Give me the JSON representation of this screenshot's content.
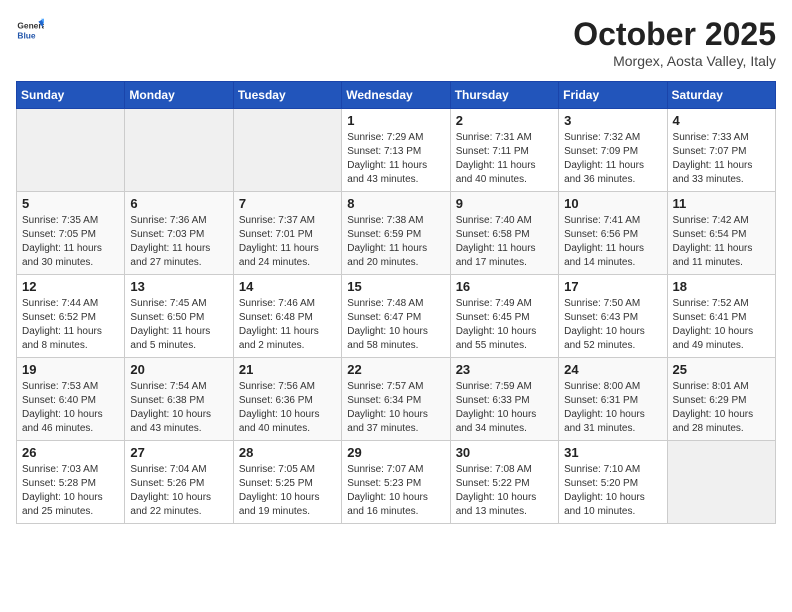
{
  "header": {
    "logo_general": "General",
    "logo_blue": "Blue",
    "month_title": "October 2025",
    "location": "Morgex, Aosta Valley, Italy"
  },
  "weekdays": [
    "Sunday",
    "Monday",
    "Tuesday",
    "Wednesday",
    "Thursday",
    "Friday",
    "Saturday"
  ],
  "weeks": [
    [
      {
        "day": "",
        "sunrise": "",
        "sunset": "",
        "daylight": ""
      },
      {
        "day": "",
        "sunrise": "",
        "sunset": "",
        "daylight": ""
      },
      {
        "day": "",
        "sunrise": "",
        "sunset": "",
        "daylight": ""
      },
      {
        "day": "1",
        "sunrise": "Sunrise: 7:29 AM",
        "sunset": "Sunset: 7:13 PM",
        "daylight": "Daylight: 11 hours and 43 minutes."
      },
      {
        "day": "2",
        "sunrise": "Sunrise: 7:31 AM",
        "sunset": "Sunset: 7:11 PM",
        "daylight": "Daylight: 11 hours and 40 minutes."
      },
      {
        "day": "3",
        "sunrise": "Sunrise: 7:32 AM",
        "sunset": "Sunset: 7:09 PM",
        "daylight": "Daylight: 11 hours and 36 minutes."
      },
      {
        "day": "4",
        "sunrise": "Sunrise: 7:33 AM",
        "sunset": "Sunset: 7:07 PM",
        "daylight": "Daylight: 11 hours and 33 minutes."
      }
    ],
    [
      {
        "day": "5",
        "sunrise": "Sunrise: 7:35 AM",
        "sunset": "Sunset: 7:05 PM",
        "daylight": "Daylight: 11 hours and 30 minutes."
      },
      {
        "day": "6",
        "sunrise": "Sunrise: 7:36 AM",
        "sunset": "Sunset: 7:03 PM",
        "daylight": "Daylight: 11 hours and 27 minutes."
      },
      {
        "day": "7",
        "sunrise": "Sunrise: 7:37 AM",
        "sunset": "Sunset: 7:01 PM",
        "daylight": "Daylight: 11 hours and 24 minutes."
      },
      {
        "day": "8",
        "sunrise": "Sunrise: 7:38 AM",
        "sunset": "Sunset: 6:59 PM",
        "daylight": "Daylight: 11 hours and 20 minutes."
      },
      {
        "day": "9",
        "sunrise": "Sunrise: 7:40 AM",
        "sunset": "Sunset: 6:58 PM",
        "daylight": "Daylight: 11 hours and 17 minutes."
      },
      {
        "day": "10",
        "sunrise": "Sunrise: 7:41 AM",
        "sunset": "Sunset: 6:56 PM",
        "daylight": "Daylight: 11 hours and 14 minutes."
      },
      {
        "day": "11",
        "sunrise": "Sunrise: 7:42 AM",
        "sunset": "Sunset: 6:54 PM",
        "daylight": "Daylight: 11 hours and 11 minutes."
      }
    ],
    [
      {
        "day": "12",
        "sunrise": "Sunrise: 7:44 AM",
        "sunset": "Sunset: 6:52 PM",
        "daylight": "Daylight: 11 hours and 8 minutes."
      },
      {
        "day": "13",
        "sunrise": "Sunrise: 7:45 AM",
        "sunset": "Sunset: 6:50 PM",
        "daylight": "Daylight: 11 hours and 5 minutes."
      },
      {
        "day": "14",
        "sunrise": "Sunrise: 7:46 AM",
        "sunset": "Sunset: 6:48 PM",
        "daylight": "Daylight: 11 hours and 2 minutes."
      },
      {
        "day": "15",
        "sunrise": "Sunrise: 7:48 AM",
        "sunset": "Sunset: 6:47 PM",
        "daylight": "Daylight: 10 hours and 58 minutes."
      },
      {
        "day": "16",
        "sunrise": "Sunrise: 7:49 AM",
        "sunset": "Sunset: 6:45 PM",
        "daylight": "Daylight: 10 hours and 55 minutes."
      },
      {
        "day": "17",
        "sunrise": "Sunrise: 7:50 AM",
        "sunset": "Sunset: 6:43 PM",
        "daylight": "Daylight: 10 hours and 52 minutes."
      },
      {
        "day": "18",
        "sunrise": "Sunrise: 7:52 AM",
        "sunset": "Sunset: 6:41 PM",
        "daylight": "Daylight: 10 hours and 49 minutes."
      }
    ],
    [
      {
        "day": "19",
        "sunrise": "Sunrise: 7:53 AM",
        "sunset": "Sunset: 6:40 PM",
        "daylight": "Daylight: 10 hours and 46 minutes."
      },
      {
        "day": "20",
        "sunrise": "Sunrise: 7:54 AM",
        "sunset": "Sunset: 6:38 PM",
        "daylight": "Daylight: 10 hours and 43 minutes."
      },
      {
        "day": "21",
        "sunrise": "Sunrise: 7:56 AM",
        "sunset": "Sunset: 6:36 PM",
        "daylight": "Daylight: 10 hours and 40 minutes."
      },
      {
        "day": "22",
        "sunrise": "Sunrise: 7:57 AM",
        "sunset": "Sunset: 6:34 PM",
        "daylight": "Daylight: 10 hours and 37 minutes."
      },
      {
        "day": "23",
        "sunrise": "Sunrise: 7:59 AM",
        "sunset": "Sunset: 6:33 PM",
        "daylight": "Daylight: 10 hours and 34 minutes."
      },
      {
        "day": "24",
        "sunrise": "Sunrise: 8:00 AM",
        "sunset": "Sunset: 6:31 PM",
        "daylight": "Daylight: 10 hours and 31 minutes."
      },
      {
        "day": "25",
        "sunrise": "Sunrise: 8:01 AM",
        "sunset": "Sunset: 6:29 PM",
        "daylight": "Daylight: 10 hours and 28 minutes."
      }
    ],
    [
      {
        "day": "26",
        "sunrise": "Sunrise: 7:03 AM",
        "sunset": "Sunset: 5:28 PM",
        "daylight": "Daylight: 10 hours and 25 minutes."
      },
      {
        "day": "27",
        "sunrise": "Sunrise: 7:04 AM",
        "sunset": "Sunset: 5:26 PM",
        "daylight": "Daylight: 10 hours and 22 minutes."
      },
      {
        "day": "28",
        "sunrise": "Sunrise: 7:05 AM",
        "sunset": "Sunset: 5:25 PM",
        "daylight": "Daylight: 10 hours and 19 minutes."
      },
      {
        "day": "29",
        "sunrise": "Sunrise: 7:07 AM",
        "sunset": "Sunset: 5:23 PM",
        "daylight": "Daylight: 10 hours and 16 minutes."
      },
      {
        "day": "30",
        "sunrise": "Sunrise: 7:08 AM",
        "sunset": "Sunset: 5:22 PM",
        "daylight": "Daylight: 10 hours and 13 minutes."
      },
      {
        "day": "31",
        "sunrise": "Sunrise: 7:10 AM",
        "sunset": "Sunset: 5:20 PM",
        "daylight": "Daylight: 10 hours and 10 minutes."
      },
      {
        "day": "",
        "sunrise": "",
        "sunset": "",
        "daylight": ""
      }
    ]
  ]
}
